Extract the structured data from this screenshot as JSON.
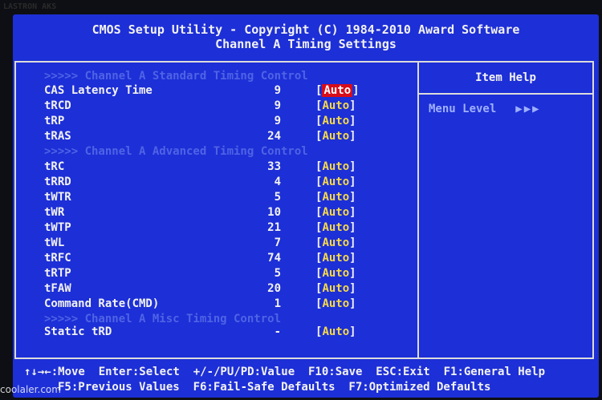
{
  "brand": "LASTRON AKS",
  "header": {
    "line1": "CMOS Setup Utility - Copyright (C) 1984-2010 Award Software",
    "line2": "Channel A Timing Settings"
  },
  "sections": {
    "standard": ">>>>>  Channel A Standard Timing Control",
    "advanced": ">>>>>  Channel A Advanced Timing Control",
    "misc": ">>>>>  Channel A Misc Timing Control"
  },
  "settings": [
    {
      "label": "CAS Latency Time",
      "value": "9",
      "option": "Auto"
    },
    {
      "label": "tRCD",
      "value": "9",
      "option": "Auto"
    },
    {
      "label": "tRP",
      "value": "9",
      "option": "Auto"
    },
    {
      "label": "tRAS",
      "value": "24",
      "option": "Auto"
    },
    {
      "label": "tRC",
      "value": "33",
      "option": "Auto"
    },
    {
      "label": "tRRD",
      "value": "4",
      "option": "Auto"
    },
    {
      "label": "tWTR",
      "value": "5",
      "option": "Auto"
    },
    {
      "label": "tWR",
      "value": "10",
      "option": "Auto"
    },
    {
      "label": "tWTP",
      "value": "21",
      "option": "Auto"
    },
    {
      "label": "tWL",
      "value": "7",
      "option": "Auto"
    },
    {
      "label": "tRFC",
      "value": "74",
      "option": "Auto"
    },
    {
      "label": "tRTP",
      "value": "5",
      "option": "Auto"
    },
    {
      "label": "tFAW",
      "value": "20",
      "option": "Auto"
    },
    {
      "label": "Command Rate(CMD)",
      "value": "1",
      "option": "Auto"
    },
    {
      "label": "Static tRD",
      "value": "-",
      "option": "Auto"
    }
  ],
  "item_help": {
    "title": "Item Help",
    "menu_level": "Menu Level",
    "arrows": "▶▶▶"
  },
  "footer": {
    "line1": "↑↓→←:Move  Enter:Select  +/-/PU/PD:Value  F10:Save  ESC:Exit  F1:General Help",
    "line2": "F5:Previous Values  F6:Fail-Safe Defaults  F7:Optimized Defaults"
  },
  "watermark": "coolaler.com",
  "colors": {
    "background": "#1d2fd6",
    "selected": "#d80c1a",
    "option": "#f7d948",
    "section": "#4f63e6"
  }
}
